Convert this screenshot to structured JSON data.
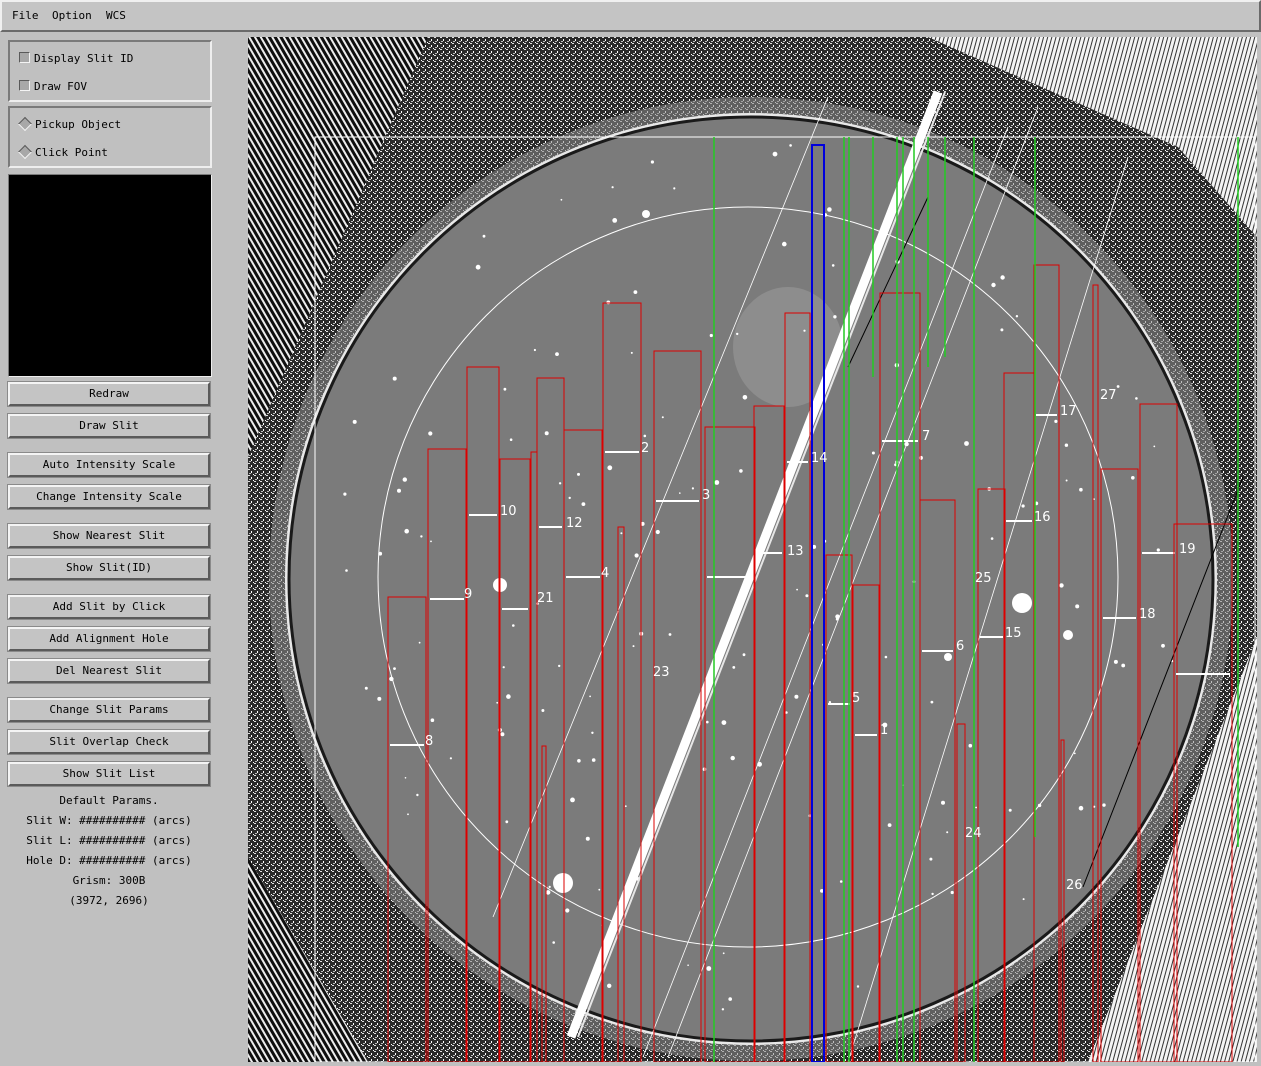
{
  "menu": [
    "File",
    "Option",
    "WCS"
  ],
  "options": {
    "display_slit_id": "Display Slit ID",
    "draw_fov": "Draw FOV",
    "pickup_object": "Pickup Object",
    "click_point": "Click Point"
  },
  "buttons": {
    "redraw": "Redraw",
    "draw_slit": "Draw Slit",
    "auto_intensity_scale": "Auto Intensity Scale",
    "change_intensity_scale": "Change Intensity Scale",
    "show_nearest_slit": "Show Nearest Slit",
    "show_slit_id": "Show Slit(ID)",
    "add_slit_by_click": "Add Slit by Click",
    "add_alignment_hole": "Add Alignment Hole",
    "del_nearest_slit": "Del Nearest Slit",
    "change_slit_params": "Change Slit Params",
    "slit_overlap_check": "Slit Overlap Check",
    "show_slit_list": "Show Slit List"
  },
  "params": {
    "heading": "Default Params.",
    "slit_w": "Slit W: ########## (arcs)",
    "slit_l": "Slit L: ########## (arcs)",
    "hole_d": "Hole D: ########## (arcs)",
    "grism": "Grism: 300B",
    "coords": "(3972, 2696)"
  },
  "slit_ids": [
    "1",
    "2",
    "3",
    "4",
    "5",
    "6",
    "7",
    "8",
    "9",
    "10",
    "12",
    "13",
    "14",
    "15",
    "16",
    "17",
    "18",
    "19",
    "21",
    "23",
    "24",
    "25",
    "26",
    "27"
  ],
  "colors": {
    "slit": "#dd0000",
    "alignment": "#22cc22",
    "selected_slit": "#0000dd",
    "overlay": "#ffffff"
  },
  "icons": {
    "checkbox": "checkbox-icon",
    "radio": "radio-icon"
  }
}
